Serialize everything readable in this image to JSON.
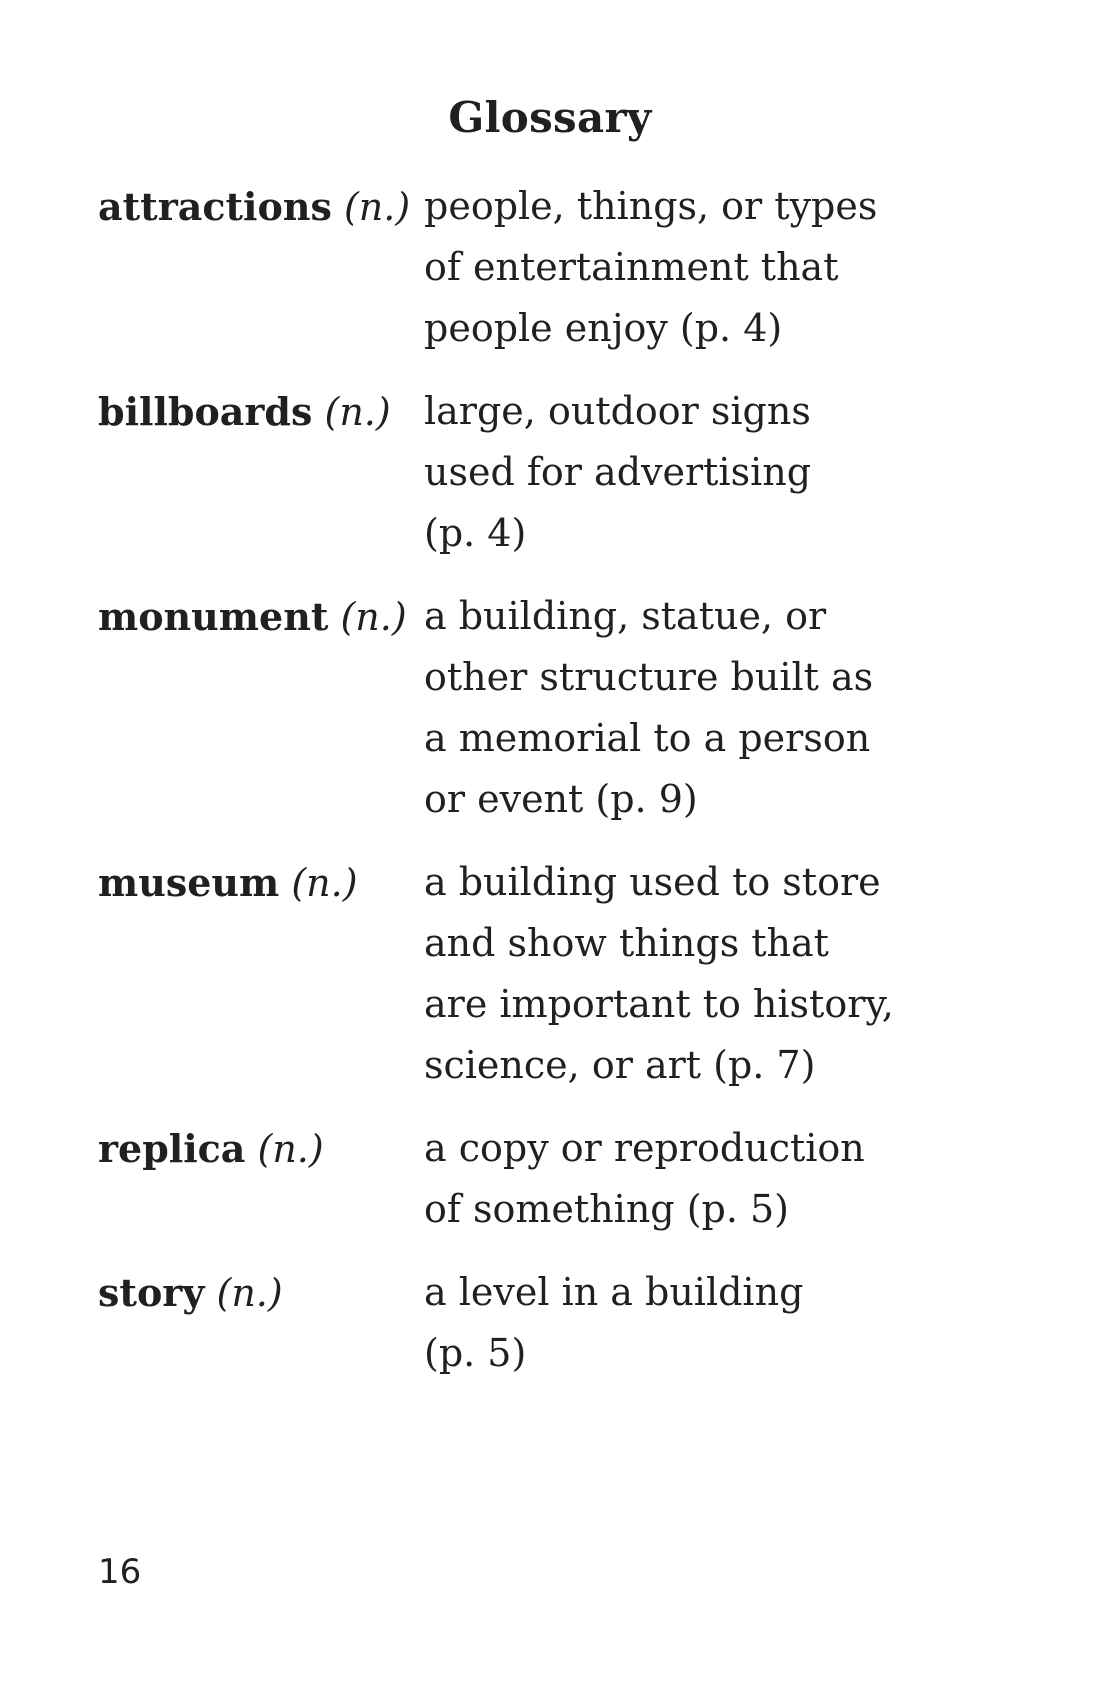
{
  "page": {
    "title": "Glossary",
    "page_number": "16"
  },
  "entries": [
    {
      "term": "attractions",
      "pos": "(n.)",
      "definition_lines": [
        "people, things, or types",
        "of entertainment that",
        "people enjoy (p. 4)"
      ]
    },
    {
      "term": "billboards",
      "pos": "(n.)",
      "definition_lines": [
        "large, outdoor signs",
        "used for advertising",
        "(p. 4)"
      ]
    },
    {
      "term": "monument",
      "pos": "(n.)",
      "definition_lines": [
        "a building, statue, or",
        "other structure built as",
        "a memorial to a person",
        "or event (p. 9)"
      ]
    },
    {
      "term": "museum",
      "pos": "(n.)",
      "definition_lines": [
        "a building used to store",
        "and show things that",
        "are important to history,",
        "science, or art (p. 7)"
      ]
    },
    {
      "term": "replica",
      "pos": "(n.)",
      "definition_lines": [
        "a copy or reproduction",
        "of something (p. 5)"
      ]
    },
    {
      "term": "story",
      "pos": "(n.)",
      "definition_lines": [
        "a level in a building",
        "(p. 5)"
      ]
    }
  ]
}
